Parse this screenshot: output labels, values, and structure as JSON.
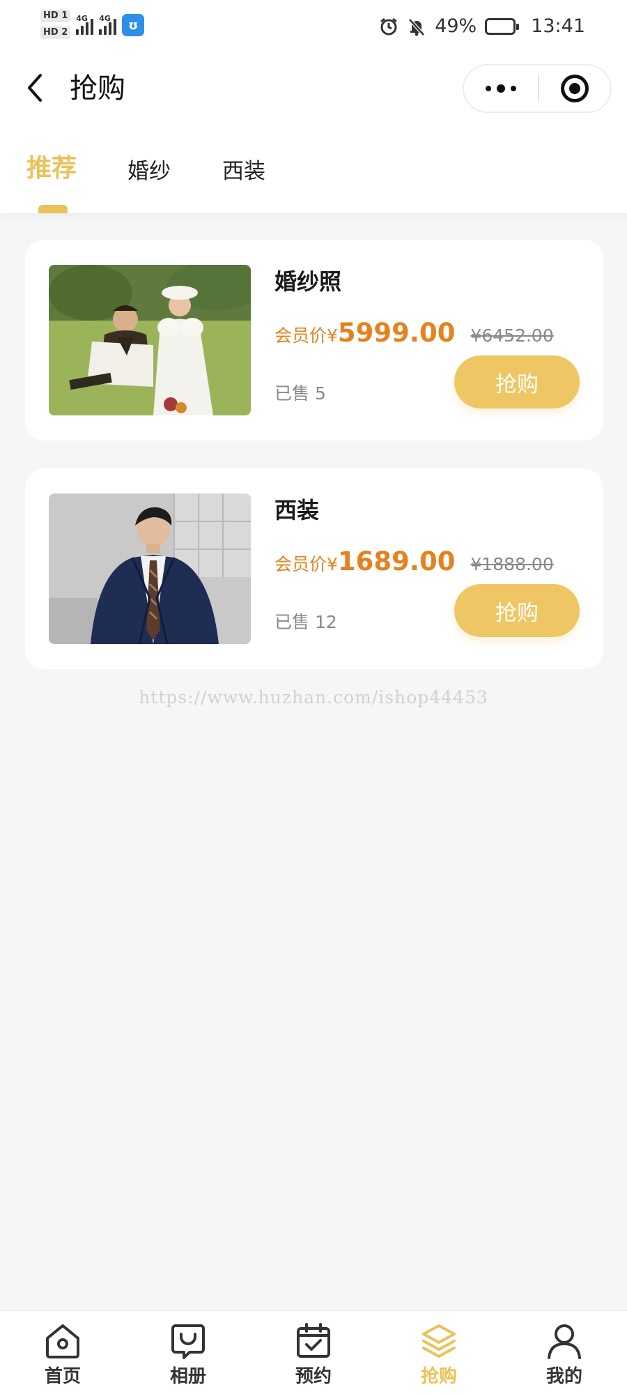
{
  "status_bar": {
    "hd1": "HD 1",
    "hd2": "HD 2",
    "net1": "4G",
    "net2": "4G",
    "battery_percent": "49%",
    "battery_level": 0.49,
    "time": "13:41",
    "icons": [
      "alarm-icon",
      "mute-bell-icon",
      "battery-icon"
    ]
  },
  "navbar": {
    "title": "抢购",
    "icons": [
      "back-arrow-icon",
      "more-dots-icon",
      "target-close-icon"
    ]
  },
  "tabs": [
    {
      "label": "推荐",
      "active": true
    },
    {
      "label": "婚纱",
      "active": false
    },
    {
      "label": "西装",
      "active": false
    }
  ],
  "products": [
    {
      "name": "婚纱照",
      "price_label": "会员价",
      "currency": "¥",
      "price": "5999.00",
      "original_price": "¥6452.00",
      "sold": "已售 5",
      "button": "抢购"
    },
    {
      "name": "西装",
      "price_label": "会员价",
      "currency": "¥",
      "price": "1689.00",
      "original_price": "¥1888.00",
      "sold": "已售 12",
      "button": "抢购"
    }
  ],
  "watermark": "https://www.huzhan.com/ishop44453",
  "tabbar": [
    {
      "label": "首页",
      "icon": "home-icon",
      "active": false
    },
    {
      "label": "相册",
      "icon": "album-icon",
      "active": false
    },
    {
      "label": "预约",
      "icon": "calendar-check-icon",
      "active": false
    },
    {
      "label": "抢购",
      "icon": "layers-icon",
      "active": true
    },
    {
      "label": "我的",
      "icon": "user-icon",
      "active": false
    }
  ],
  "colors": {
    "accent": "#e9c25a",
    "price": "#e6821e",
    "background": "#f5f6f8"
  }
}
